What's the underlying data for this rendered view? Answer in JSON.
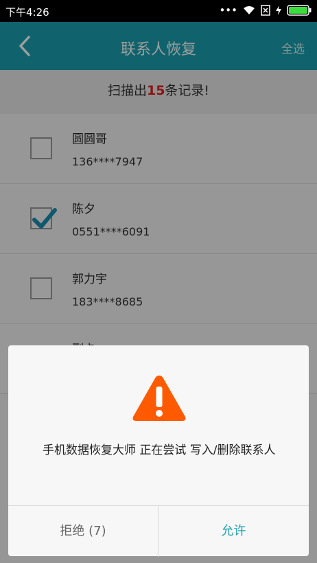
{
  "status": {
    "time": "下午4:26"
  },
  "header": {
    "title": "联系人恢复",
    "select_all": "全选"
  },
  "summary": {
    "prefix": "扫描出",
    "count": "15",
    "suffix": "条记录!"
  },
  "contacts": [
    {
      "name": "圆圆哥",
      "phone": "136****7947",
      "checked": false
    },
    {
      "name": "陈夕",
      "phone": "0551****6091",
      "checked": true
    },
    {
      "name": "郭力宇",
      "phone": "183****8685",
      "checked": false
    },
    {
      "name": "副卡",
      "phone": "",
      "checked": false
    }
  ],
  "dialog": {
    "message": "手机数据恢复大师 正在尝试 写入/删除联系人",
    "deny_label": "拒绝 (7)",
    "allow_label": "允许",
    "warning_color": "#ff5a00"
  },
  "colors": {
    "accent": "#1aa1ae"
  }
}
